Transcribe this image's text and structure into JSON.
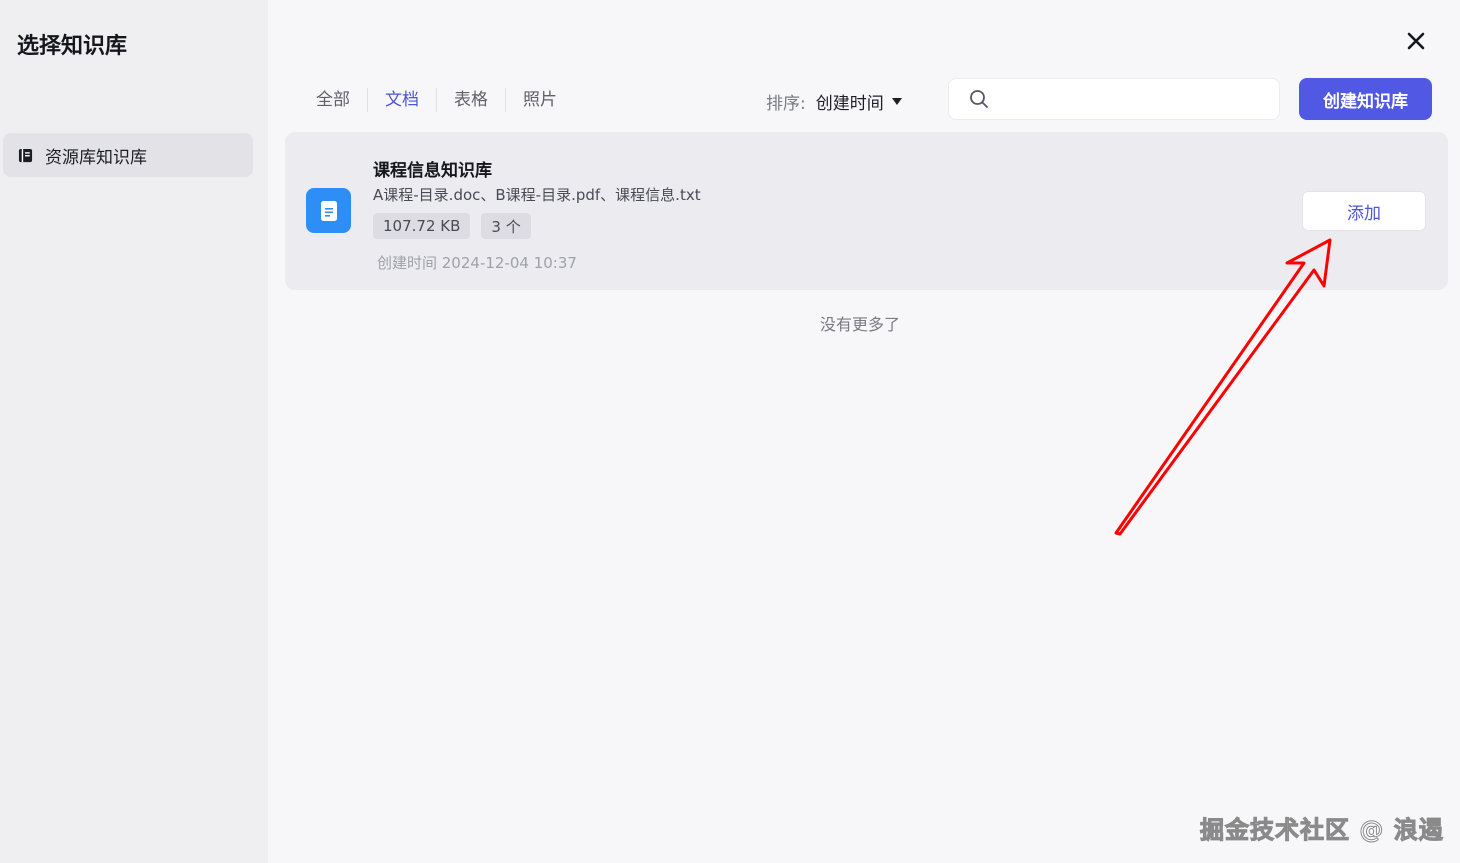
{
  "sidebar": {
    "title": "选择知识库",
    "items": [
      {
        "label": "资源库知识库",
        "icon": "book-icon",
        "active": true
      }
    ]
  },
  "header": {
    "tabs": [
      {
        "label": "全部",
        "active": false
      },
      {
        "label": "文档",
        "active": true
      },
      {
        "label": "表格",
        "active": false
      },
      {
        "label": "照片",
        "active": false
      }
    ],
    "sort_label": "排序:",
    "sort_value": "创建时间",
    "search_placeholder": "",
    "create_button": "创建知识库",
    "close_icon": "close-icon"
  },
  "list": {
    "items": [
      {
        "name": "课程信息知识库",
        "files": "A课程-目录.doc、B课程-目录.pdf、课程信息.txt",
        "size": "107.72 KB",
        "count": "3 个",
        "created": "创建时间 2024-12-04 10:37",
        "add_label": "添加",
        "icon": "document-icon"
      }
    ],
    "end_text": "没有更多了"
  },
  "watermark": "掘金技术社区 @ 浪遏",
  "colors": {
    "accent": "#5159e4",
    "active_tab": "#4b55d6",
    "file_icon_bg": "#2d8ef6",
    "annotation_arrow": "#ff0000"
  }
}
